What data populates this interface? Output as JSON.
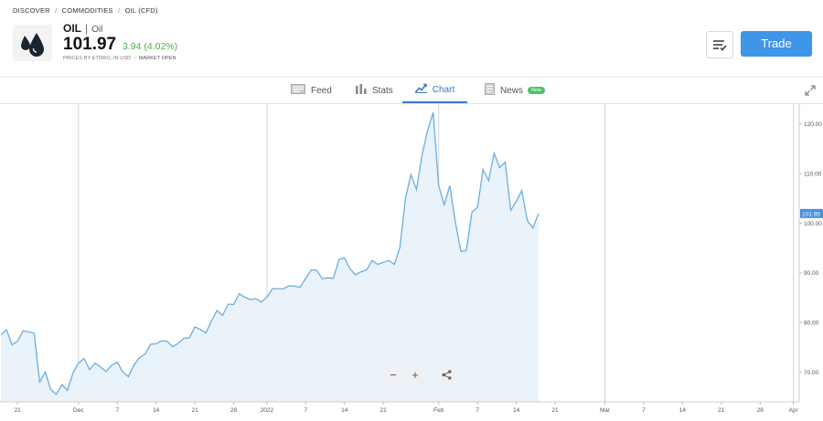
{
  "breadcrumb": {
    "items": [
      "DISCOVER",
      "COMMODITIES",
      "OIL (CFD)"
    ],
    "sep": "/"
  },
  "asset": {
    "symbol": "OIL",
    "name": "Oil",
    "price": "101.97",
    "change": "3.94 (4.02%)",
    "priced_by": "PRICES BY ETORO, IN USD",
    "market_status": "MARKET OPEN"
  },
  "actions": {
    "trade_label": "Trade"
  },
  "tabs": [
    {
      "label": "Feed",
      "icon": "feed-icon"
    },
    {
      "label": "Stats",
      "icon": "stats-icon"
    },
    {
      "label": "Chart",
      "icon": "chart-icon",
      "active": true
    },
    {
      "label": "News",
      "icon": "news-icon",
      "badge": "New"
    }
  ],
  "colors": {
    "accent": "#3f95e8",
    "positive": "#4cae4c",
    "line": "#6aaee0",
    "fill": "#eaf2fa",
    "badge": "#4cc36b"
  },
  "chart_data": {
    "type": "area",
    "ylim": [
      64,
      124
    ],
    "y_ticks": [
      "70.00",
      "80.00",
      "90.00",
      "100.00",
      "110.00",
      "120.00"
    ],
    "y_tick_values": [
      70,
      80,
      90,
      100,
      110,
      120
    ],
    "current_label": "101.95",
    "current_value": 101.95,
    "x_tick_labels": [
      "21",
      "Dec",
      "7",
      "14",
      "21",
      "28",
      "2022",
      "7",
      "14",
      "21",
      "Feb",
      "7",
      "14",
      "21",
      "Mar",
      "7",
      "14",
      "21",
      "28",
      "Apr"
    ],
    "x_tick_index": [
      3,
      14,
      21,
      28,
      35,
      42,
      48,
      55,
      62,
      69,
      79,
      86,
      93,
      100,
      109,
      116,
      123,
      130,
      137,
      143
    ],
    "month_lines_index": [
      14,
      48,
      79,
      109,
      143
    ],
    "values": [
      77.5,
      78.5,
      75.5,
      76.2,
      78.3,
      78.1,
      77.8,
      68.0,
      70.0,
      66.5,
      65.5,
      67.5,
      66.3,
      69.8,
      71.8,
      72.7,
      70.5,
      71.8,
      71.0,
      70.1,
      71.4,
      72.0,
      70.0,
      69.1,
      71.4,
      72.9,
      73.6,
      75.6,
      75.7,
      76.3,
      76.2,
      75.1,
      75.8,
      76.8,
      76.9,
      79.1,
      78.6,
      77.9,
      80.3,
      82.4,
      81.4,
      83.7,
      83.6,
      85.8,
      85.1,
      84.6,
      84.8,
      84.1,
      85.1,
      86.8,
      86.8,
      86.8,
      87.4,
      87.3,
      87.1,
      88.9,
      90.6,
      90.5,
      88.8,
      89.0,
      88.9,
      92.7,
      93.0,
      90.8,
      89.6,
      90.2,
      90.6,
      92.5,
      91.7,
      92.1,
      92.5,
      91.7,
      95.1,
      105.0,
      109.8,
      106.8,
      113.8,
      118.7,
      122.3,
      107.6,
      103.7,
      107.6,
      100.3,
      94.3,
      94.5,
      102.2,
      103.2,
      110.8,
      108.6,
      114.1,
      111.2,
      112.3,
      102.6,
      104.4,
      106.6,
      100.5,
      99.0,
      101.95
    ]
  }
}
